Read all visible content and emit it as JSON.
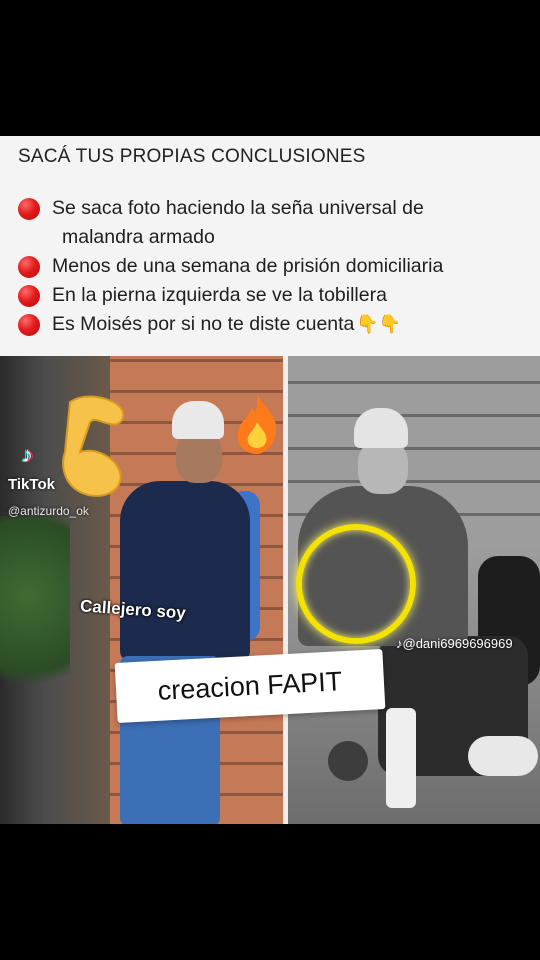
{
  "header": {
    "title": "SACÁ TUS PROPIAS CONCLUSIONES"
  },
  "bullets": [
    {
      "line1": "Se saca foto haciendo la seña universal de",
      "line2": "malandra armado"
    },
    {
      "line1": "Menos de una semana de prisión domiciliaria"
    },
    {
      "line1": "En la pierna izquierda se ve la tobillera"
    },
    {
      "line1": "Es Moisés por si no te diste cuenta",
      "emoji": "👇👇"
    }
  ],
  "left_photo": {
    "tiktok_brand": "TikTok",
    "tiktok_user": "@antizurdo_ok",
    "caption": "Callejero soy"
  },
  "right_photo": {
    "watermark": "@dani6969696969"
  },
  "label": {
    "text": "creacion FAPIT"
  },
  "colors": {
    "bullet_red": "#e21c1c",
    "highlight_ring": "#f4e200"
  }
}
